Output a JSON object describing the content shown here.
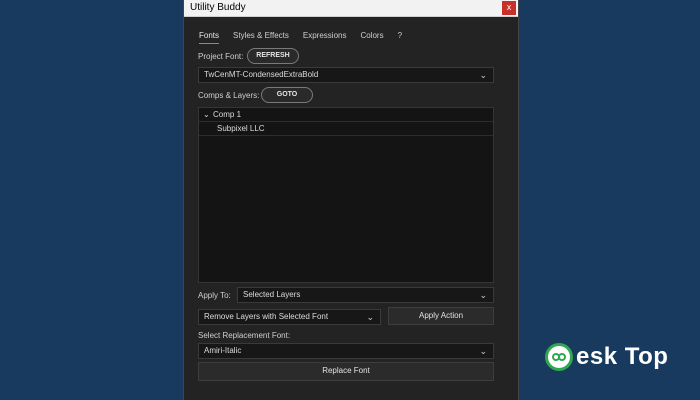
{
  "window": {
    "title": "Utility Buddy",
    "close_label": "x"
  },
  "tabs": [
    {
      "label": "Fonts"
    },
    {
      "label": "Styles & Effects"
    },
    {
      "label": "Expressions"
    },
    {
      "label": "Colors"
    },
    {
      "label": "?"
    }
  ],
  "project_font": {
    "label": "Project Font:",
    "refresh_label": "REFRESH",
    "value": "TwCenMT-CondensedExtraBold"
  },
  "comps_layers": {
    "label": "Comps & Layers:",
    "goto_label": "GOTO",
    "tree": [
      {
        "label": "Comp 1",
        "expanded": true
      },
      {
        "label": "Subpixel LLC"
      }
    ]
  },
  "apply_to": {
    "label": "Apply To:",
    "value": "Selected Layers"
  },
  "action": {
    "value": "Remove Layers with Selected Font",
    "apply_label": "Apply Action"
  },
  "replacement": {
    "label": "Select Replacement Font:",
    "value": "Amiri-Italic",
    "replace_label": "Replace Font"
  },
  "watermark": {
    "text": "esk Top"
  },
  "colors": {
    "background": "#173a5e",
    "panel": "#232323",
    "close": "#c8312b",
    "logo_ring": "#2fa84f"
  }
}
